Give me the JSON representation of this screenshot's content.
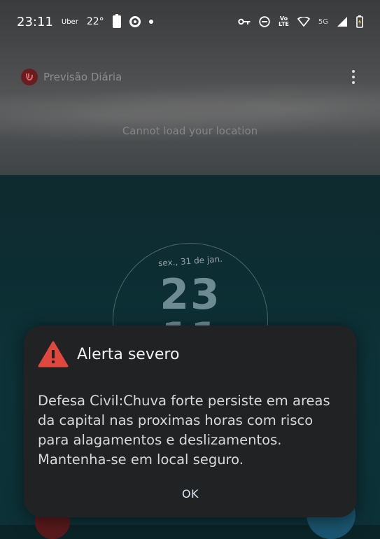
{
  "status_bar": {
    "time": "23:11",
    "carrier_app": "Uber",
    "temperature": "22°",
    "network_type": "5G",
    "volte_top": "Vo",
    "volte_bottom": "LTE"
  },
  "app": {
    "name": "Previsão Diária",
    "location_message": "Cannot load your location"
  },
  "clock": {
    "date": "sex., 31 de jan.",
    "hour": "23",
    "minute": "11"
  },
  "alert": {
    "title": "Alerta severo",
    "message": "Defesa Civil:Chuva forte persiste em areas da capital nas proximas horas com risco para alagamentos e deslizamentos. Mantenha-se em local seguro.",
    "ok_label": "OK",
    "icon": "warning-triangle-icon",
    "icon_color": "#e0483e"
  }
}
